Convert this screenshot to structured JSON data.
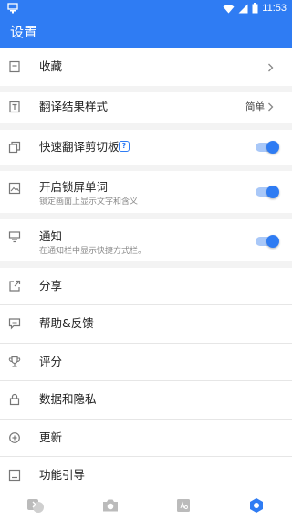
{
  "status_bar": {
    "time": "11:53",
    "icons": [
      "notification-icon",
      "wifi-icon",
      "signal-icon",
      "battery-icon"
    ]
  },
  "app_bar": {
    "title": "设置"
  },
  "settings": {
    "favorites": {
      "label": "收藏",
      "icon": "bookmark-icon"
    },
    "result_style": {
      "label": "翻译结果样式",
      "value": "简单",
      "icon": "text-format-icon"
    },
    "clipboard": {
      "label": "快速翻译剪切板",
      "help": "?",
      "enabled": true,
      "icon": "clipboard-icon"
    },
    "lockscreen": {
      "label": "开启锁屏单词",
      "subtitle": "锁定画面上显示文字和含义",
      "enabled": true,
      "icon": "image-icon"
    },
    "notification": {
      "label": "通知",
      "subtitle": "在通知栏中显示快捷方式栏。",
      "enabled": true,
      "icon": "notification-bar-icon"
    },
    "share": {
      "label": "分享",
      "icon": "share-icon"
    },
    "feedback": {
      "label": "帮助&反馈",
      "icon": "feedback-icon"
    },
    "rate": {
      "label": "评分",
      "icon": "trophy-icon"
    },
    "privacy": {
      "label": "数据和隐私",
      "icon": "lock-icon"
    },
    "update": {
      "label": "更新",
      "icon": "update-icon"
    },
    "guide": {
      "label": "功能引导",
      "icon": "guide-icon"
    }
  },
  "bottom_nav": {
    "items": [
      "translate-icon",
      "camera-icon",
      "dictionary-icon",
      "settings-icon"
    ],
    "active": "settings-icon"
  },
  "colors": {
    "accent": "#2f7cf3",
    "toggle_track": "#a9c8f8"
  }
}
